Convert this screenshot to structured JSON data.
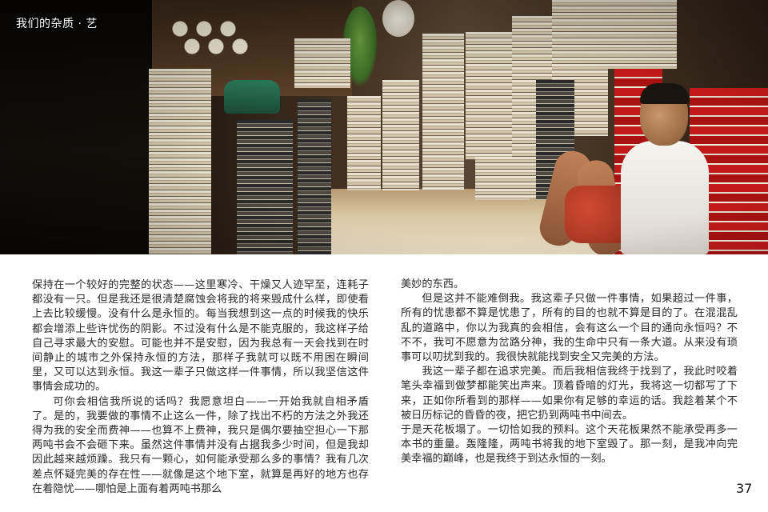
{
  "header": {
    "magazine_title": "我们的杂质 · 艺"
  },
  "photo": {
    "description_icon": "bookstore-photo"
  },
  "left_column": {
    "paragraphs": [
      "保持在一个较好的完整的状态——这里寒冷、干燥又人迹罕至，连耗子都没有一只。但是我还是很清楚腐蚀会将我的将来毁成什么样，即使看上去比较缓慢。没有什么是永恒的。每当我想到这一点的时候我的快乐都会增添上些许忧伤的阴影。不过没有什么是不能克服的，我这样子给自己寻求最大的安慰。可能也并不是安慰，因为我总有一天会找到在时间静止的城市之外保持永恒的方法，那样子我就可以既不用困在瞬间里，又可以达到永恒。我这一辈子只做这样一件事情，所以我坚信这件事情会成功的。",
      "可你会相信我所说的话吗？我愿意坦白——一开始我就自相矛盾了。是的，我要做的事情不止这么一件，除了找出不朽的方法之外我还得为我的安全而费神——也算不上费神，我只是偶尔要抽空担心一下那两吨书会不会砸下来。虽然这件事情并没有占据我多少时间，但是我却因此越来越烦躁。我只有一颗心，如何能承受那么多的事情？我有几次差点怀疑完美的存在性——就像是这个地下室，就算是再好的地方也存在着隐忧——哪怕是上面有着两吨书那么"
    ]
  },
  "right_column": {
    "paragraphs": [
      "美妙的东西。",
      "但是这并不能难倒我。我这辈子只做一件事情，如果超过一件事，所有的忧患都不算是忧患了，所有的目的也就不算是目的了。在混混乱乱的道路中，你以为我真的会相信，会有这么一个目的通向永恒吗？不不不，我可不愿意为岔路分神，我的生命中只有一条大道。从来没有琐事可以叨扰到我的。我很快就能找到安全又完美的方法。",
      "我这一辈子都在追求完美。而后我相信我终于找到了，我此时咬着笔头幸福到做梦都能笑出声来。顶着昏暗的灯光，我将这一切都写了下来，正如你所看到的那样——如果你有足够的幸运的话。我趁着某个不被日历标记的昏昏的夜，把它扔到两吨书中间去。",
      "于是天花板塌了。一切恰如我的预料。这个天花板果然不能承受再多一本书的重量。轰隆隆，两吨书将我的地下室毁了。那一刻，是我冲向完美幸福的巅峰，也是我终于到达永恒的一刻。"
    ]
  },
  "footer": {
    "page_number": "37"
  }
}
